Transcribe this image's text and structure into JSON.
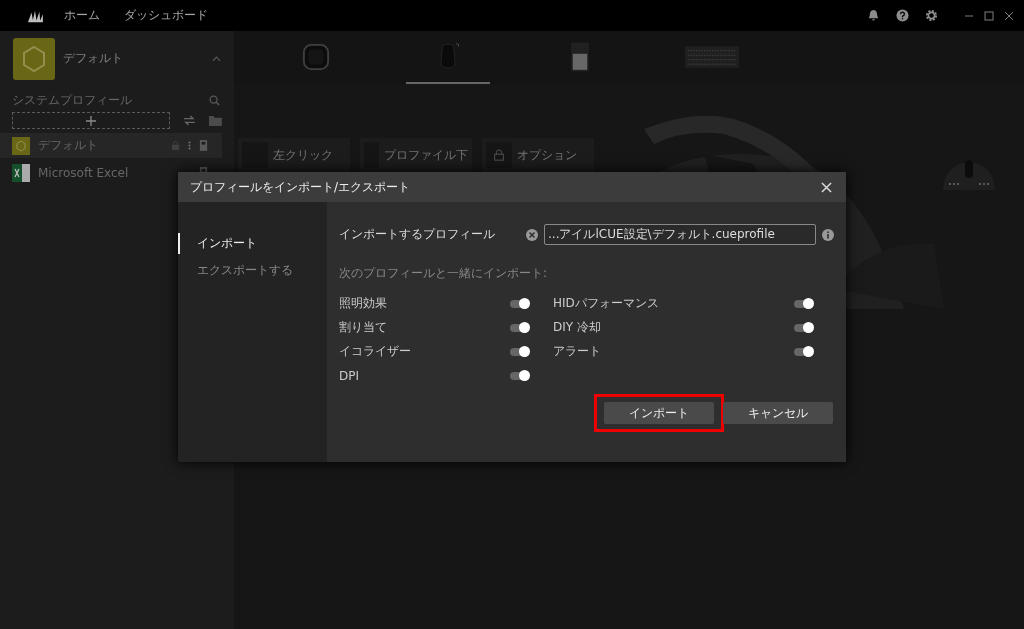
{
  "topbar": {
    "nav": [
      {
        "label": "ホーム"
      },
      {
        "label": "ダッシュボード"
      }
    ]
  },
  "sidebar": {
    "current_profile": {
      "name": "デフォルト",
      "expanded": true
    },
    "section_title": "システムプロフィール",
    "profiles": [
      {
        "name": "デフォルト",
        "kind": "default",
        "selected": true
      },
      {
        "name": "Microsoft Excel",
        "kind": "excel",
        "selected": false
      }
    ]
  },
  "devices": [
    {
      "kind": "hub",
      "selected": false
    },
    {
      "kind": "mouse",
      "selected": true
    },
    {
      "kind": "dongle",
      "selected": false
    },
    {
      "kind": "keyboard",
      "selected": false
    }
  ],
  "actions": [
    {
      "label": "左クリック",
      "kind": "blank"
    },
    {
      "label": "プロファイル下",
      "kind": "blank"
    },
    {
      "label": "オプション",
      "kind": "lock"
    }
  ],
  "dialog": {
    "title": "プロフィールをインポート/エクスポート",
    "tabs": [
      {
        "label": "インポート",
        "selected": true
      },
      {
        "label": "エクスポートする",
        "selected": false
      }
    ],
    "file_label": "インポートするプロフィール",
    "file_value": "...アイルlCUE設定\\デフォルト.cueprofile",
    "with_label": "次のプロフィールと一緒にインポート:",
    "options": [
      {
        "label": "照明効果",
        "on": true
      },
      {
        "label": "HIDパフォーマンス",
        "on": true
      },
      {
        "label": "割り当て",
        "on": true
      },
      {
        "label": "DIY 冷却",
        "on": true
      },
      {
        "label": "イコライザー",
        "on": true
      },
      {
        "label": "アラート",
        "on": true
      },
      {
        "label": "DPI",
        "on": true
      }
    ],
    "buttons": [
      {
        "label": "インポート",
        "highlighted": true
      },
      {
        "label": "キャンセル",
        "highlighted": false
      }
    ]
  }
}
